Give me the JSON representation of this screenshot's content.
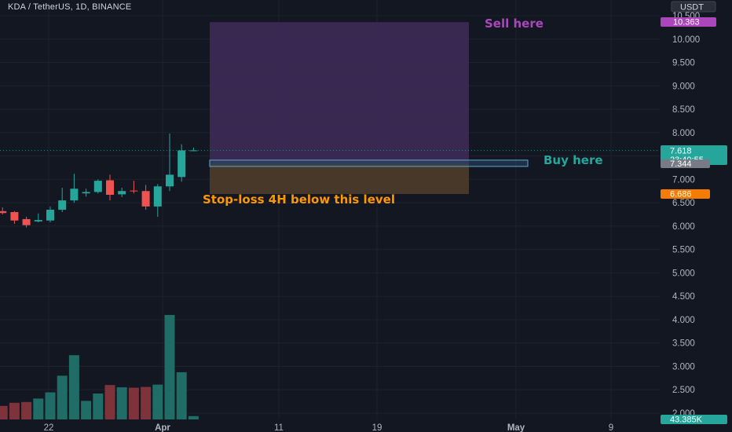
{
  "header": {
    "symbol_title": "KDA / TetherUS, 1D, BINANCE",
    "currency": "USDT"
  },
  "colors": {
    "background": "#131722",
    "grid": "#1e222d",
    "up": "#26a69a",
    "down": "#ef5350",
    "vol_up": "#1f6d66",
    "vol_down": "#7d3339",
    "sell_zone": "#3b2a54",
    "stop_zone": "#4a3a2a",
    "sell_text": "#ab47bc",
    "buy_text": "#26a69a",
    "stop_text": "#ff9800"
  },
  "annotations": {
    "sell_label": "Sell here",
    "buy_label": "Buy here",
    "stop_label": "Stop-loss 4H below this level"
  },
  "price_tags": {
    "sell_value": "10.363",
    "last_price": "7.618",
    "countdown": "23:40:55",
    "buy_value": "7.344",
    "stop_value": "6.686",
    "volume_value": "43.385K"
  },
  "chart_data": {
    "type": "candlestick",
    "price_axis": {
      "ylim": [
        1.85,
        10.7
      ],
      "ticks": [
        "10.500",
        "10.000",
        "9.500",
        "9.000",
        "8.500",
        "8.000",
        "7.500",
        "7.000",
        "6.500",
        "6.000",
        "5.500",
        "5.000",
        "4.500",
        "4.000",
        "3.500",
        "3.000",
        "2.500",
        "2.000"
      ],
      "tick_values": [
        10.5,
        10.0,
        9.5,
        9.0,
        8.5,
        8.0,
        7.5,
        7.0,
        6.5,
        6.0,
        5.5,
        5.0,
        4.5,
        4.0,
        3.5,
        3.0,
        2.5,
        2.0
      ]
    },
    "time_axis": {
      "labels": [
        "22",
        "Apr",
        "11",
        "19",
        "May",
        "9"
      ],
      "bold": [
        "Apr",
        "May"
      ]
    },
    "candles": [
      {
        "o": 6.25,
        "h": 6.42,
        "l": 6.12,
        "c": 6.32
      },
      {
        "o": 6.32,
        "h": 6.4,
        "l": 6.25,
        "c": 6.28
      },
      {
        "o": 6.3,
        "h": 6.32,
        "l": 6.05,
        "c": 6.12
      },
      {
        "o": 6.15,
        "h": 6.2,
        "l": 5.97,
        "c": 6.02
      },
      {
        "o": 6.1,
        "h": 6.27,
        "l": 6.08,
        "c": 6.13
      },
      {
        "o": 6.12,
        "h": 6.42,
        "l": 6.08,
        "c": 6.35
      },
      {
        "o": 6.35,
        "h": 6.82,
        "l": 6.3,
        "c": 6.55
      },
      {
        "o": 6.55,
        "h": 7.12,
        "l": 6.5,
        "c": 6.8
      },
      {
        "o": 6.7,
        "h": 6.8,
        "l": 6.63,
        "c": 6.73
      },
      {
        "o": 6.73,
        "h": 7.0,
        "l": 6.7,
        "c": 6.97
      },
      {
        "o": 6.98,
        "h": 7.1,
        "l": 6.55,
        "c": 6.67
      },
      {
        "o": 6.68,
        "h": 6.82,
        "l": 6.62,
        "c": 6.75
      },
      {
        "o": 6.76,
        "h": 6.97,
        "l": 6.7,
        "c": 6.75
      },
      {
        "o": 6.75,
        "h": 6.88,
        "l": 6.35,
        "c": 6.42
      },
      {
        "o": 6.42,
        "h": 6.9,
        "l": 6.2,
        "c": 6.85
      },
      {
        "o": 6.85,
        "h": 7.98,
        "l": 6.75,
        "c": 7.1
      },
      {
        "o": 7.05,
        "h": 7.75,
        "l": 6.95,
        "c": 7.62
      },
      {
        "o": 7.62,
        "h": 7.68,
        "l": 7.6,
        "c": 7.62
      }
    ],
    "volume_unit": "USDT",
    "volume_values": [
      250000,
      175000,
      215000,
      225000,
      270000,
      350000,
      565000,
      830000,
      240000,
      335000,
      445000,
      415000,
      410000,
      420000,
      450000,
      1350000,
      610000,
      43385
    ],
    "levels": {
      "sell_top": 10.363,
      "buy": 7.344,
      "stop": 6.686,
      "last": 7.618
    }
  }
}
